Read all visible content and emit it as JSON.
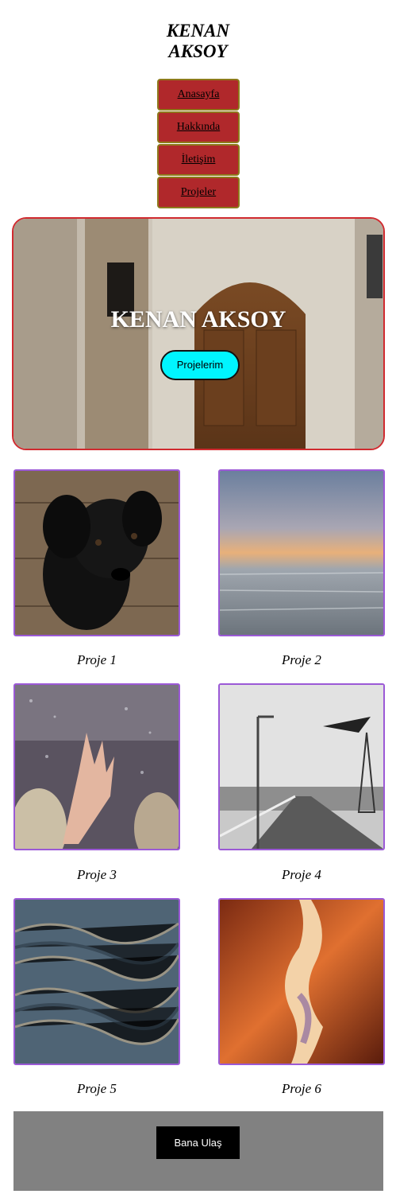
{
  "header": {
    "title_line1": "KENAN",
    "title_line2": "AKSOY"
  },
  "nav": {
    "items": [
      {
        "label": "Anasayfa"
      },
      {
        "label": "Hakkında"
      },
      {
        "label": "İletişim"
      },
      {
        "label": "Projeler"
      }
    ]
  },
  "hero": {
    "title": "KENAN AKSOY",
    "button_label": "Projelerim",
    "button_color": "#00f5ff",
    "border_color": "#d02a2f"
  },
  "projects": [
    {
      "caption": "Proje 1",
      "image": "black-puppy-photo"
    },
    {
      "caption": "Proje 2",
      "image": "sea-sunset-photo"
    },
    {
      "caption": "Proje 3",
      "image": "hand-on-rainy-window-photo"
    },
    {
      "caption": "Proje 4",
      "image": "pier-lighthouse-photo"
    },
    {
      "caption": "Proje 5",
      "image": "water-texture-photo"
    },
    {
      "caption": "Proje 6",
      "image": "canyon-photo"
    }
  ],
  "footer": {
    "button_label": "Bana Ulaş"
  },
  "colors": {
    "nav_bg": "#b0282b",
    "card_border": "#9b59d6",
    "footer_bg": "#818181"
  }
}
